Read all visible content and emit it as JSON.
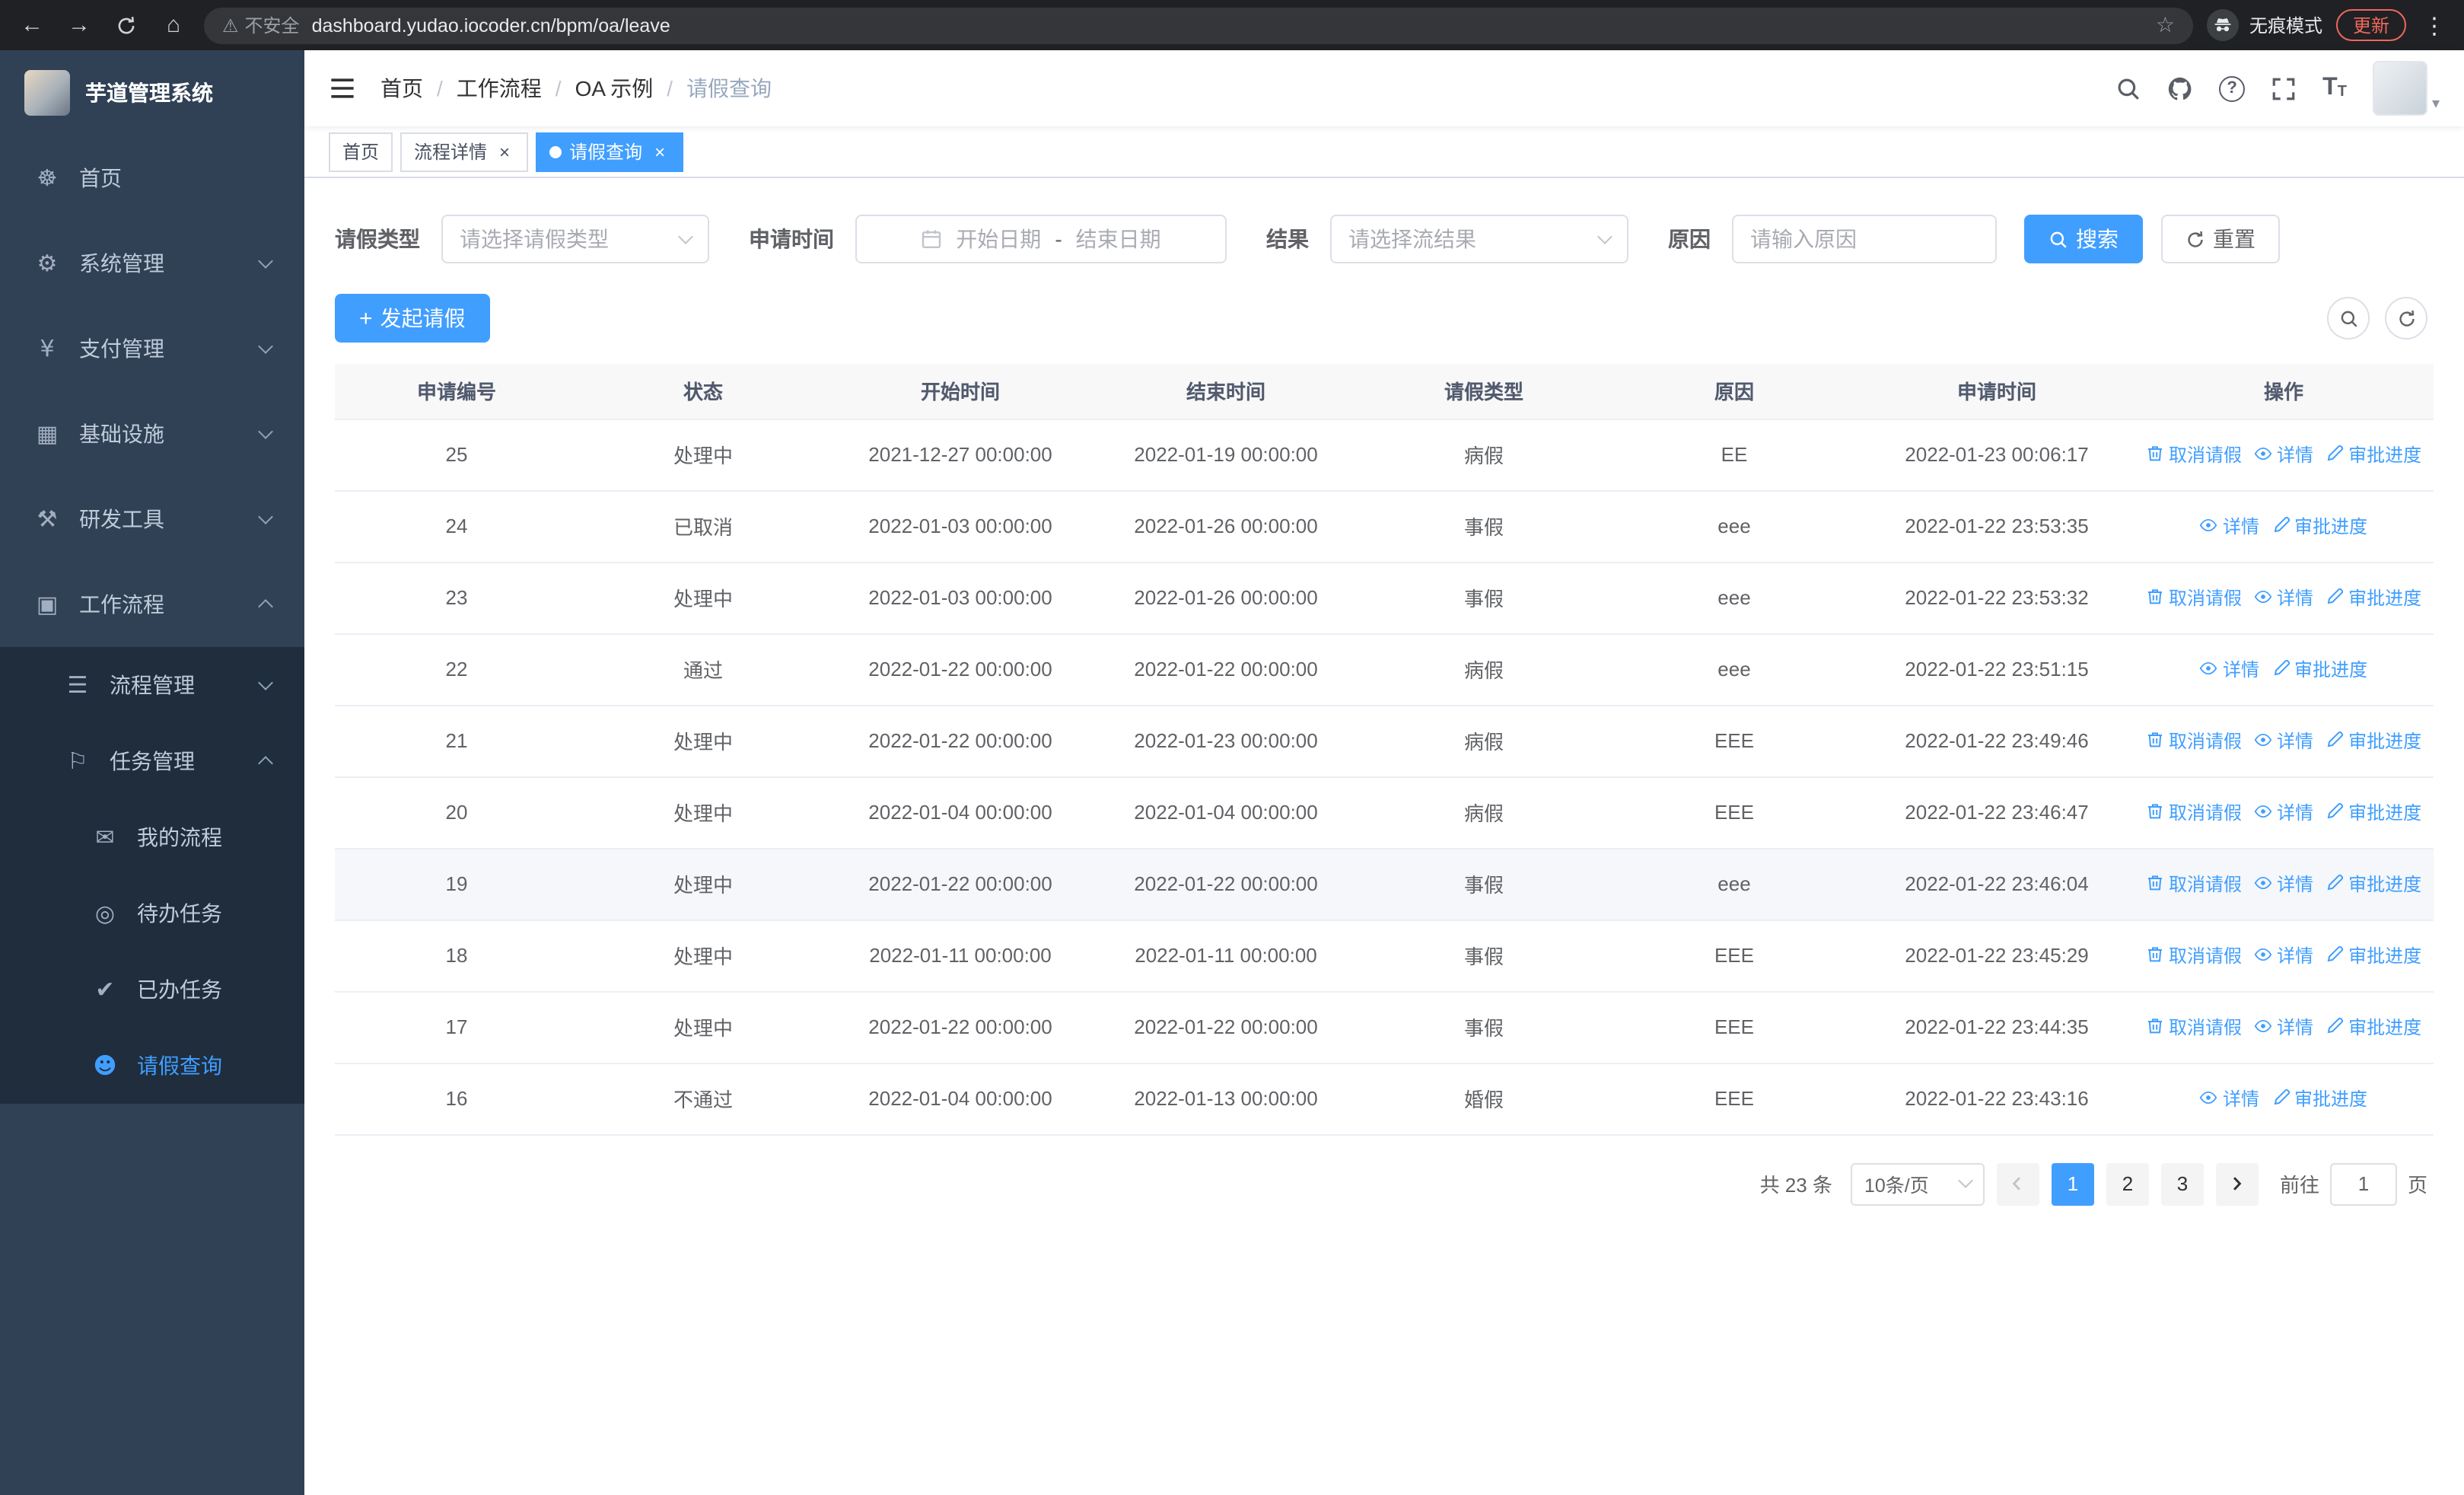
{
  "colors": {
    "primary": "#409eff",
    "sidebar_bg": "#304156",
    "submenu_bg": "#1f2d3d"
  },
  "icons": {
    "back": "←",
    "forward": "→",
    "home": "⌂",
    "warning": "⚠",
    "star": "☆",
    "dots": "⋮",
    "caret": "▾",
    "question": "?",
    "font_large": "T",
    "font_small": "T",
    "plus": "+"
  },
  "browser": {
    "security": "不安全",
    "url": "dashboard.yudao.iocoder.cn/bpm/oa/leave",
    "incognito": "无痕模式",
    "update": "更新"
  },
  "sidebar": {
    "title": "芋道管理系统",
    "items": [
      {
        "key": "home",
        "label": "首页",
        "icon": "dashboard-icon",
        "glyph": "☸",
        "level": 1,
        "arrow": ""
      },
      {
        "key": "system",
        "label": "系统管理",
        "icon": "gear-icon",
        "glyph": "⚙",
        "level": 1,
        "arrow": "down"
      },
      {
        "key": "payment",
        "label": "支付管理",
        "icon": "yen-icon",
        "glyph": "¥",
        "level": 1,
        "arrow": "down"
      },
      {
        "key": "infra",
        "label": "基础设施",
        "icon": "infrastructure-icon",
        "glyph": "▦",
        "level": 1,
        "arrow": "down"
      },
      {
        "key": "devtools",
        "label": "研发工具",
        "icon": "tools-icon",
        "glyph": "⚒",
        "level": 1,
        "arrow": "down"
      },
      {
        "key": "workflow",
        "label": "工作流程",
        "icon": "briefcase-icon",
        "glyph": "▣",
        "level": 1,
        "arrow": "up"
      },
      {
        "key": "process-mgmt",
        "label": "流程管理",
        "icon": "process-list-icon",
        "glyph": "☰",
        "level": 2,
        "arrow": "down"
      },
      {
        "key": "task-mgmt",
        "label": "任务管理",
        "icon": "task-flag-icon",
        "glyph": "⚐",
        "level": 2,
        "arrow": "up"
      },
      {
        "key": "my-process",
        "label": "我的流程",
        "icon": "message-icon",
        "glyph": "✉",
        "level": 3,
        "arrow": ""
      },
      {
        "key": "todo-tasks",
        "label": "待办任务",
        "icon": "eye-icon",
        "glyph": "◎",
        "level": 3,
        "arrow": ""
      },
      {
        "key": "done-tasks",
        "label": "已办任务",
        "icon": "check-icon",
        "glyph": "✔",
        "level": 3,
        "arrow": ""
      },
      {
        "key": "leave-query",
        "label": "请假查询",
        "icon": "user-icon",
        "glyph": "☻",
        "level": 3,
        "arrow": "",
        "active": true
      }
    ]
  },
  "header": {
    "breadcrumb": [
      "首页",
      "工作流程",
      "OA 示例",
      "请假查询"
    ],
    "separator": "/"
  },
  "tags": [
    {
      "label": "首页"
    },
    {
      "label": "流程详情"
    },
    {
      "label": "请假查询"
    }
  ],
  "filters": {
    "leave_type_label": "请假类型",
    "leave_type_placeholder": "请选择请假类型",
    "apply_time_label": "申请时间",
    "start_date_placeholder": "开始日期",
    "date_separator": "-",
    "end_date_placeholder": "结束日期",
    "result_label": "结果",
    "result_placeholder": "请选择流结果",
    "reason_label": "原因",
    "reason_placeholder": "请输入原因",
    "reason_value": "",
    "search_button": "搜索",
    "reset_button": "重置"
  },
  "toolbar": {
    "create_button": "发起请假"
  },
  "table": {
    "columns": [
      "申请编号",
      "状态",
      "开始时间",
      "结束时间",
      "请假类型",
      "原因",
      "申请时间",
      "操作"
    ],
    "actions": {
      "cancel": "取消请假",
      "detail": "详情",
      "progress": "审批进度"
    },
    "rows": [
      {
        "id": "25",
        "status": "处理中",
        "start": "2021-12-27 00:00:00",
        "end": "2022-01-19 00:00:00",
        "type": "病假",
        "reason": "EE",
        "applied": "2022-01-23 00:06:17",
        "cancelable": true
      },
      {
        "id": "24",
        "status": "已取消",
        "start": "2022-01-03 00:00:00",
        "end": "2022-01-26 00:00:00",
        "type": "事假",
        "reason": "eee",
        "applied": "2022-01-22 23:53:35",
        "cancelable": false
      },
      {
        "id": "23",
        "status": "处理中",
        "start": "2022-01-03 00:00:00",
        "end": "2022-01-26 00:00:00",
        "type": "事假",
        "reason": "eee",
        "applied": "2022-01-22 23:53:32",
        "cancelable": true
      },
      {
        "id": "22",
        "status": "通过",
        "start": "2022-01-22 00:00:00",
        "end": "2022-01-22 00:00:00",
        "type": "病假",
        "reason": "eee",
        "applied": "2022-01-22 23:51:15",
        "cancelable": false
      },
      {
        "id": "21",
        "status": "处理中",
        "start": "2022-01-22 00:00:00",
        "end": "2022-01-23 00:00:00",
        "type": "病假",
        "reason": "EEE",
        "applied": "2022-01-22 23:49:46",
        "cancelable": true
      },
      {
        "id": "20",
        "status": "处理中",
        "start": "2022-01-04 00:00:00",
        "end": "2022-01-04 00:00:00",
        "type": "病假",
        "reason": "EEE",
        "applied": "2022-01-22 23:46:47",
        "cancelable": true
      },
      {
        "id": "19",
        "status": "处理中",
        "start": "2022-01-22 00:00:00",
        "end": "2022-01-22 00:00:00",
        "type": "事假",
        "reason": "eee",
        "applied": "2022-01-22 23:46:04",
        "cancelable": true,
        "hover": true
      },
      {
        "id": "18",
        "status": "处理中",
        "start": "2022-01-11 00:00:00",
        "end": "2022-01-11 00:00:00",
        "type": "事假",
        "reason": "EEE",
        "applied": "2022-01-22 23:45:29",
        "cancelable": true
      },
      {
        "id": "17",
        "status": "处理中",
        "start": "2022-01-22 00:00:00",
        "end": "2022-01-22 00:00:00",
        "type": "事假",
        "reason": "EEE",
        "applied": "2022-01-22 23:44:35",
        "cancelable": true
      },
      {
        "id": "16",
        "status": "不通过",
        "start": "2022-01-04 00:00:00",
        "end": "2022-01-13 00:00:00",
        "type": "婚假",
        "reason": "EEE",
        "applied": "2022-01-22 23:43:16",
        "cancelable": false
      }
    ]
  },
  "pagination": {
    "total_text": "共 23 条",
    "page_size": "10条/页",
    "pages": [
      "1",
      "2",
      "3"
    ],
    "active_page": "1",
    "goto_label": "前往",
    "goto_value": "1",
    "page_label": "页"
  }
}
